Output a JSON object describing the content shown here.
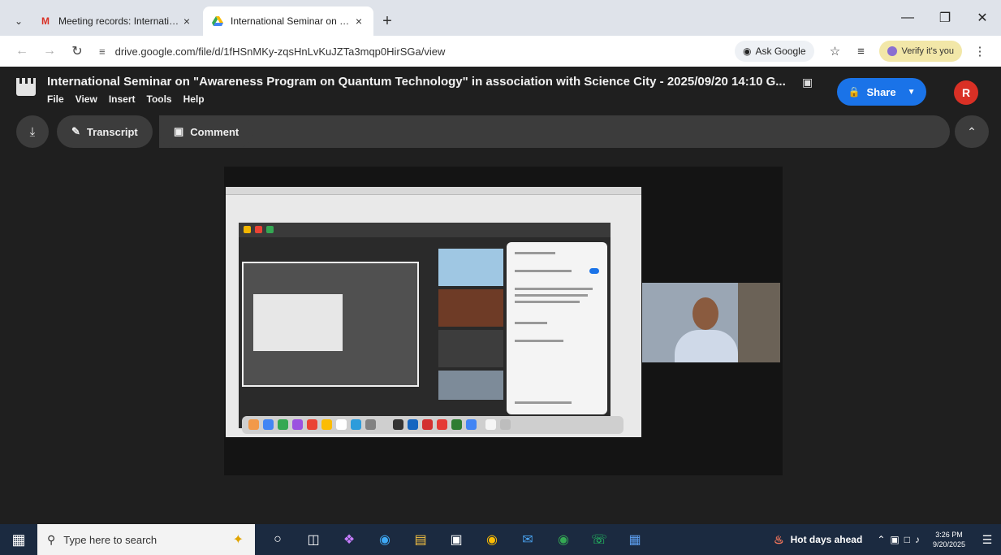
{
  "browser": {
    "tabs": [
      {
        "title": "Meeting records: Internationa",
        "favicon": "gmail-icon",
        "active": false
      },
      {
        "title": "International Seminar on \"Awa",
        "favicon": "drive-icon",
        "active": true
      }
    ],
    "new_tab": "+",
    "url": "drive.google.com/file/d/1fHSnMKy-zqsHnLvKuJZTa3mqp0HirSGa/view",
    "ask_google": "Ask Google",
    "verify_label": "Verify it's you"
  },
  "viewer": {
    "title": "International Seminar on \"Awareness Program on Quantum Technology\" in association with Science City - 2025/09/20 14:10 G...",
    "menu": [
      "File",
      "View",
      "Insert",
      "Tools",
      "Help"
    ],
    "share_label": "Share",
    "avatar_initial": "R",
    "toolbar": {
      "transcript_label": "Transcript",
      "comment_label": "Comment"
    }
  },
  "taskbar": {
    "search_placeholder": "Type here to search",
    "weather": "Hot days ahead",
    "time": "3:26 PM",
    "date": "9/20/2025"
  },
  "colors": {
    "viewer_bg": "#1f1f1f",
    "share_blue": "#1a73e8",
    "avatar_red": "#d93025",
    "taskbar_bg": "#1b2a40"
  }
}
